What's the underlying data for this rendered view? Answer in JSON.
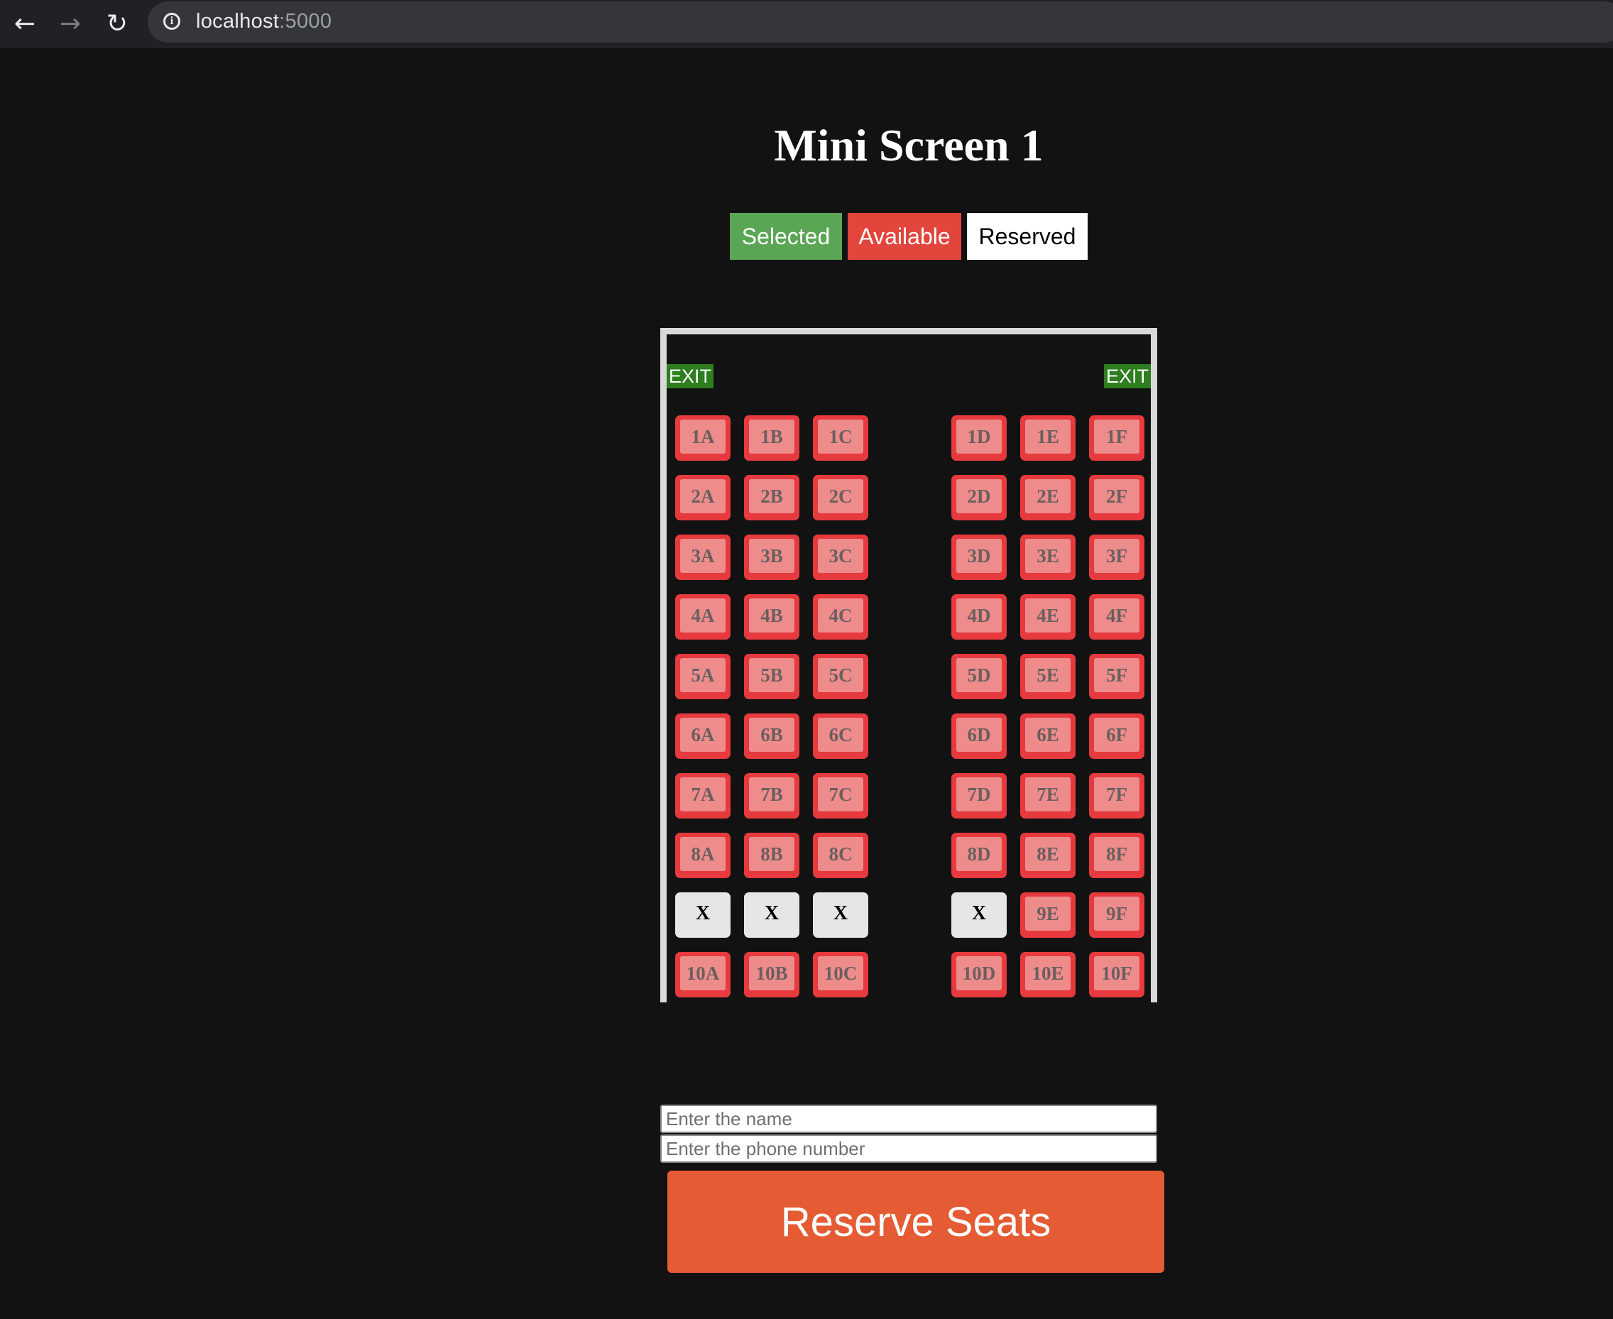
{
  "browser": {
    "back_icon": "arrow-left-icon",
    "forward_icon": "arrow-right-icon",
    "reload_icon": "reload-icon",
    "info_icon": "info-icon",
    "url_host": "localhost",
    "url_port": ":5000"
  },
  "page": {
    "title": "Mini Screen 1"
  },
  "legend": {
    "selected": "Selected",
    "available": "Available",
    "reserved": "Reserved",
    "colors": {
      "selected": "#5aa654",
      "available": "#e2453c",
      "reserved": "#ffffff"
    }
  },
  "theater": {
    "exit_left": "EXIT",
    "exit_right": "EXIT",
    "rows": [
      {
        "seats": [
          {
            "label": "1A",
            "status": "available"
          },
          {
            "label": "1B",
            "status": "available"
          },
          {
            "label": "1C",
            "status": "available"
          },
          {
            "label": "1D",
            "status": "available"
          },
          {
            "label": "1E",
            "status": "available"
          },
          {
            "label": "1F",
            "status": "available"
          }
        ]
      },
      {
        "seats": [
          {
            "label": "2A",
            "status": "available"
          },
          {
            "label": "2B",
            "status": "available"
          },
          {
            "label": "2C",
            "status": "available"
          },
          {
            "label": "2D",
            "status": "available"
          },
          {
            "label": "2E",
            "status": "available"
          },
          {
            "label": "2F",
            "status": "available"
          }
        ]
      },
      {
        "seats": [
          {
            "label": "3A",
            "status": "available"
          },
          {
            "label": "3B",
            "status": "available"
          },
          {
            "label": "3C",
            "status": "available"
          },
          {
            "label": "3D",
            "status": "available"
          },
          {
            "label": "3E",
            "status": "available"
          },
          {
            "label": "3F",
            "status": "available"
          }
        ]
      },
      {
        "seats": [
          {
            "label": "4A",
            "status": "available"
          },
          {
            "label": "4B",
            "status": "available"
          },
          {
            "label": "4C",
            "status": "available"
          },
          {
            "label": "4D",
            "status": "available"
          },
          {
            "label": "4E",
            "status": "available"
          },
          {
            "label": "4F",
            "status": "available"
          }
        ]
      },
      {
        "seats": [
          {
            "label": "5A",
            "status": "available"
          },
          {
            "label": "5B",
            "status": "available"
          },
          {
            "label": "5C",
            "status": "available"
          },
          {
            "label": "5D",
            "status": "available"
          },
          {
            "label": "5E",
            "status": "available"
          },
          {
            "label": "5F",
            "status": "available"
          }
        ]
      },
      {
        "seats": [
          {
            "label": "6A",
            "status": "available"
          },
          {
            "label": "6B",
            "status": "available"
          },
          {
            "label": "6C",
            "status": "available"
          },
          {
            "label": "6D",
            "status": "available"
          },
          {
            "label": "6E",
            "status": "available"
          },
          {
            "label": "6F",
            "status": "available"
          }
        ]
      },
      {
        "seats": [
          {
            "label": "7A",
            "status": "available"
          },
          {
            "label": "7B",
            "status": "available"
          },
          {
            "label": "7C",
            "status": "available"
          },
          {
            "label": "7D",
            "status": "available"
          },
          {
            "label": "7E",
            "status": "available"
          },
          {
            "label": "7F",
            "status": "available"
          }
        ]
      },
      {
        "seats": [
          {
            "label": "8A",
            "status": "available"
          },
          {
            "label": "8B",
            "status": "available"
          },
          {
            "label": "8C",
            "status": "available"
          },
          {
            "label": "8D",
            "status": "available"
          },
          {
            "label": "8E",
            "status": "available"
          },
          {
            "label": "8F",
            "status": "available"
          }
        ]
      },
      {
        "seats": [
          {
            "label": "X",
            "status": "reserved"
          },
          {
            "label": "X",
            "status": "reserved"
          },
          {
            "label": "X",
            "status": "reserved"
          },
          {
            "label": "X",
            "status": "reserved"
          },
          {
            "label": "9E",
            "status": "available"
          },
          {
            "label": "9F",
            "status": "available"
          }
        ]
      },
      {
        "seats": [
          {
            "label": "10A",
            "status": "available"
          },
          {
            "label": "10B",
            "status": "available"
          },
          {
            "label": "10C",
            "status": "available"
          },
          {
            "label": "10D",
            "status": "available"
          },
          {
            "label": "10E",
            "status": "available"
          },
          {
            "label": "10F",
            "status": "available"
          }
        ]
      }
    ]
  },
  "form": {
    "name_placeholder": "Enter the name",
    "name_value": "",
    "phone_placeholder": "Enter the phone number",
    "phone_value": "",
    "submit_label": "Reserve Seats"
  }
}
